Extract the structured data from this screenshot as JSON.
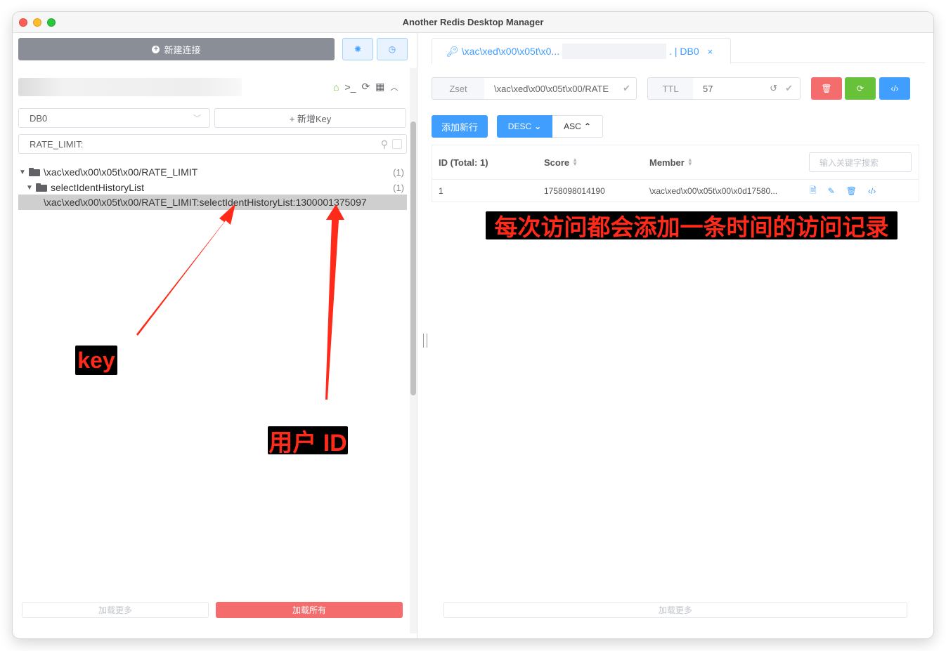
{
  "window": {
    "title": "Another Redis Desktop Manager"
  },
  "sidebar": {
    "new_connection_label": "新建连接",
    "db_select": "DB0",
    "new_key_label": "+ 新增Key",
    "search_value": "RATE_LIMIT:",
    "tree": [
      {
        "label": "\\xac\\xed\\x00\\x05t\\x00/RATE_LIMIT",
        "count": "(1)"
      },
      {
        "label": "selectIdentHistoryList",
        "count": "(1)"
      }
    ],
    "selected_key": "\\xac\\xed\\x00\\x05t\\x00/RATE_LIMIT:selectIdentHistoryList:1300001375097",
    "load_more_label": "加载更多",
    "load_all_label": "加载所有"
  },
  "tab": {
    "prefix": "\\xac\\xed\\x00\\x05t\\x0...",
    "suffix": ". | DB0",
    "close": "×"
  },
  "keyinfo": {
    "type_label": "Zset",
    "key_value": "\\xac\\xed\\x00\\x05t\\x00/RATE",
    "ttl_label": "TTL",
    "ttl_value": "57"
  },
  "toolbar": {
    "add_row_label": "添加新行",
    "desc_label": "DESC",
    "asc_label": "ASC"
  },
  "table": {
    "headers": {
      "id": "ID (Total: 1)",
      "score": "Score",
      "member": "Member"
    },
    "search_placeholder": "输入关键字搜索",
    "rows": [
      {
        "id": "1",
        "score": "1758098014190",
        "member": "\\xac\\xed\\x00\\x05t\\x00\\x0d17580..."
      }
    ]
  },
  "main": {
    "load_more_label": "加载更多"
  },
  "annotations": {
    "key": "key",
    "user_id": "用户 ID",
    "note": "每次访问都会添加一条时间的访问记录"
  },
  "colors": {
    "danger": "#f56c6c",
    "success": "#67c23a",
    "primary": "#409eff",
    "annotation": "#ff2a1a"
  }
}
